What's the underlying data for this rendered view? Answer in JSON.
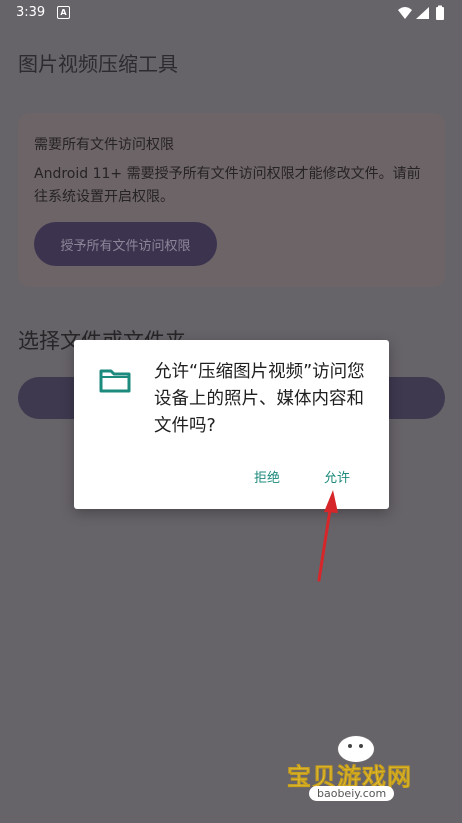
{
  "status_bar": {
    "time": "3:39",
    "notification_icon": "app-notification-icon",
    "wifi_icon": "wifi-icon",
    "signal_icon": "signal-icon",
    "battery_icon": "battery-icon"
  },
  "app": {
    "title": "图片视频压缩工具"
  },
  "permission_card": {
    "title": "需要所有文件访问权限",
    "description": "Android 11+ 需要授予所有文件访问权限才能修改文件。请前往系统设置开启权限。",
    "button_label": "授予所有文件访问权限"
  },
  "file_section": {
    "title": "选择文件或文件夹"
  },
  "dialog": {
    "icon": "folder-icon",
    "message": "允许“压缩图片视频”访问您设备上的照片、媒体内容和文件吗?",
    "deny_label": "拒绝",
    "allow_label": "允许",
    "accent_color": "#1c8a7c"
  },
  "annotation": {
    "icon": "red-arrow-icon",
    "color": "#d7262a"
  },
  "watermark": {
    "name": "宝贝游戏网",
    "url": "baobeiy.com"
  }
}
